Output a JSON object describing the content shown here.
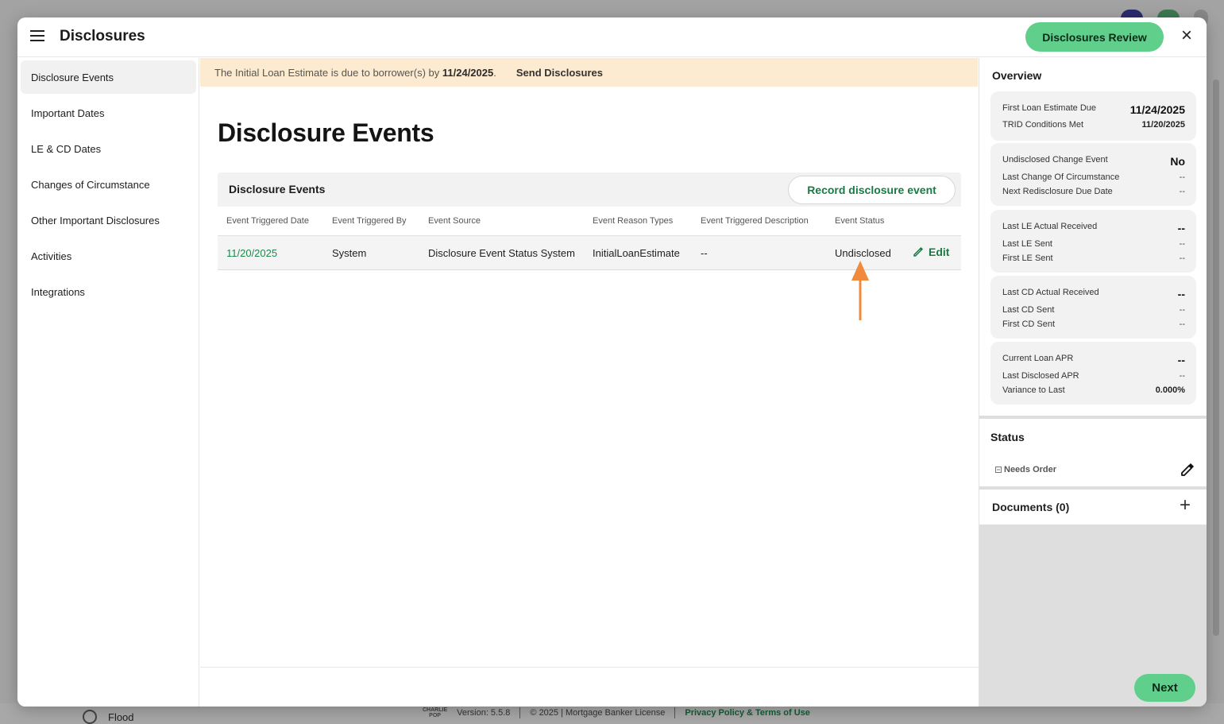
{
  "background": {
    "flood_label": "Flood",
    "footer": {
      "logo_line1": "CHARLIE",
      "logo_line2": "POP",
      "version": "Version: 5.5.8",
      "copyright": "© 2025 | Mortgage Banker License",
      "link": "Privacy Policy & Terms of Use"
    }
  },
  "header": {
    "title": "Disclosures",
    "review_button": "Disclosures Review",
    "close_icon": "×"
  },
  "sidebar": {
    "items": [
      {
        "label": "Disclosure Events",
        "active": true
      },
      {
        "label": "Important Dates"
      },
      {
        "label": "LE & CD Dates"
      },
      {
        "label": "Changes of Circumstance"
      },
      {
        "label": "Other Important Disclosures"
      },
      {
        "label": "Activities"
      },
      {
        "label": "Integrations"
      }
    ]
  },
  "banner": {
    "prefix": "The Initial Loan Estimate is due to borrower(s) by",
    "date": "11/24/2025",
    "suffix": ".",
    "action": "Send Disclosures"
  },
  "main": {
    "page_title": "Disclosure Events",
    "card_title": "Disclosure Events",
    "record_button": "Record disclosure event",
    "columns": [
      "Event Triggered Date",
      "Event Triggered By",
      "Event Source",
      "Event Reason Types",
      "Event Triggered Description",
      "Event Status"
    ],
    "rows": [
      {
        "date": "11/20/2025",
        "by": "System",
        "source": "Disclosure Event Status System",
        "reason": "InitialLoanEstimate",
        "description": "--",
        "status": "Undisclosed",
        "edit": "Edit"
      }
    ],
    "annotation_color": "#f08a3c"
  },
  "overview": {
    "title": "Overview",
    "cards": [
      {
        "rows": [
          {
            "label": "First Loan Estimate Due",
            "value": "11/24/2025"
          },
          {
            "label": "TRID Conditions Met",
            "value": "11/20/2025"
          }
        ]
      },
      {
        "rows": [
          {
            "label": "Undisclosed Change Event",
            "value": "No"
          },
          {
            "label": "Last Change Of Circumstance",
            "value": "--"
          },
          {
            "label": "Next Redisclosure Due Date",
            "value": "--"
          }
        ]
      },
      {
        "rows": [
          {
            "label": "Last LE Actual Received",
            "value": "--"
          },
          {
            "label": "Last LE Sent",
            "value": "--"
          },
          {
            "label": "First LE Sent",
            "value": "--"
          }
        ]
      },
      {
        "rows": [
          {
            "label": "Last CD Actual Received",
            "value": "--"
          },
          {
            "label": "Last CD Sent",
            "value": "--"
          },
          {
            "label": "First CD Sent",
            "value": "--"
          }
        ]
      },
      {
        "rows": [
          {
            "label": "Current Loan APR",
            "value": "--"
          },
          {
            "label": "Last Disclosed APR",
            "value": "--"
          },
          {
            "label": "Variance to Last",
            "value": "0.000%"
          }
        ]
      }
    ]
  },
  "status": {
    "title": "Status",
    "value": "Needs Order"
  },
  "documents": {
    "title": "Documents (0)",
    "add_icon": "+"
  },
  "footer": {
    "next_button": "Next"
  },
  "colors": {
    "accent": "#5fcf8b",
    "link_green": "#187a44",
    "banner_bg": "#fcebd0"
  }
}
